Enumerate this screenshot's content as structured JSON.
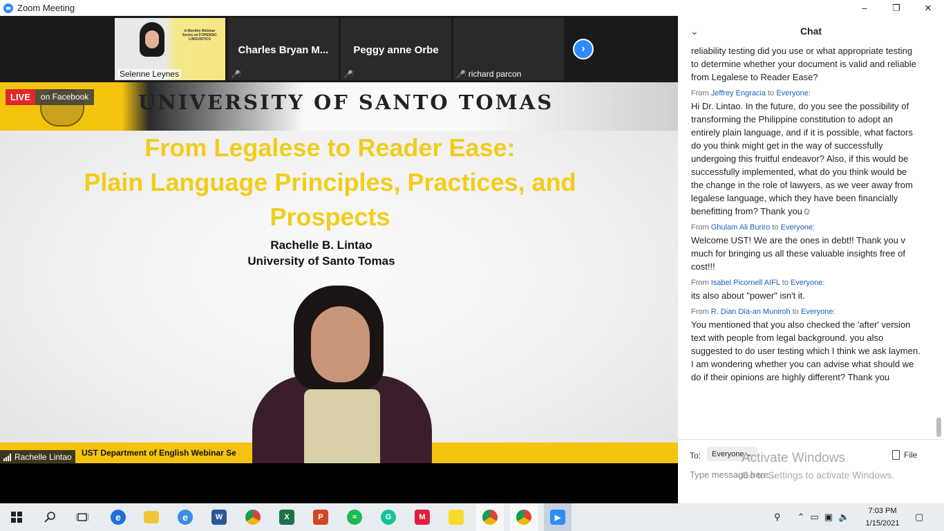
{
  "window": {
    "title": "Zoom Meeting",
    "minimize": "–",
    "restore": "❐",
    "close": "✕"
  },
  "live": {
    "badge": "LIVE",
    "platform": "on Facebook"
  },
  "participants": [
    {
      "name": "Selenne Leynes",
      "muted": false
    },
    {
      "name": "Charles  Bryan  M...",
      "muted": true
    },
    {
      "name": "Peggy anne Orbe",
      "muted": true
    },
    {
      "name": "richard parcon",
      "muted": true
    }
  ],
  "poster_text": "A Monthly Webinar Series on FORENSIC LINGUISTICS",
  "slide": {
    "header": "UNIVERSITY OF SANTO TOMAS",
    "title_line1": "From Legalese to Reader Ease:",
    "title_line2": "Plain Language Principles, Practices, and",
    "title_line3": "Prospects",
    "author": "Rachelle B. Lintao",
    "affiliation": "University of Santo Tomas",
    "footer": "UST Department of English Webinar Se"
  },
  "active_speaker": "Rachelle Lintao",
  "chat": {
    "title": "Chat",
    "messages": [
      {
        "from": "",
        "to": "",
        "text": "reliability testing did you use or what appropriate testing to determine whether your document is valid and reliable from Legalese to Reader Ease?"
      },
      {
        "from": "Jeffrey Engracia",
        "to": "Everyone:",
        "text": "Hi Dr. Lintao. In the future, do you see the possibility of transforming the Philippine constitution to adopt an entirely plain language, and if it is possible, what factors do you think might get in the way of successfully undergoing this fruitful endeavor? Also, if this would be successfully implemented, what do you think would be the change in the role of lawyers, as we veer away from legalese language, which they have been financially benefitting from? Thank you☺"
      },
      {
        "from": "Ghulam Ali Buriro",
        "to": "Everyone:",
        "text": "Welcome UST! We are the ones in debt!! Thank you v much for bringing us all these valuable insights free of cost!!!"
      },
      {
        "from": "Isabel Picornell AIFL",
        "to": "Everyone:",
        "text": "its also about \"power\" isn't it."
      },
      {
        "from": "R. Dian Dia-an Muniroh",
        "to": "Everyone:",
        "text": "You mentioned that you also checked the 'after' version text with people from legal background. you also suggested to do user testing which I think we ask laymen. I am wondering whether you can advise what should we do if their opinions are highly different? Thank you"
      }
    ],
    "from_prefix": "From",
    "to_word": "to",
    "to_label": "To:",
    "recipient": "Everyone",
    "file_label": "File",
    "placeholder": "Type message here..."
  },
  "watermark": {
    "line1": "Activate Windows",
    "line2": "Go to Settings to activate Windows."
  },
  "clock": {
    "time": "7:03 PM",
    "date": "1/15/2021"
  },
  "colors": {
    "zoom_blue": "#2D8CFF",
    "ust_gold": "#F4C30E",
    "title_yellow": "#F2CD1A",
    "live_red": "#E02828"
  }
}
